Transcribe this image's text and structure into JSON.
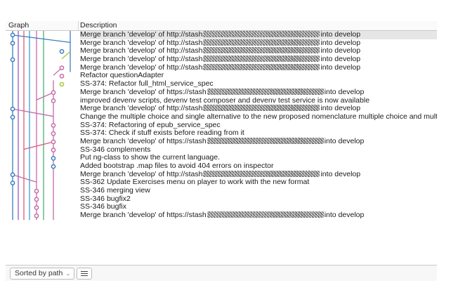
{
  "header": {
    "graph": "Graph",
    "description": "Description"
  },
  "commits": [
    {
      "pre": "Merge branch 'develop' of http://stash",
      "redact": 166,
      "post": "into develop",
      "dot": 0,
      "color": "#3a7fc0"
    },
    {
      "pre": "Merge branch 'develop' of http://stash",
      "redact": 166,
      "post": "into develop",
      "dot": 0,
      "color": "#3a7fc0"
    },
    {
      "pre": "Merge branch 'develop' of http://stash",
      "redact": 166,
      "post": "into develop",
      "dot": 7,
      "color": "#3a7fc0"
    },
    {
      "pre": "Merge branch 'develop' of http://stash",
      "redact": 166,
      "post": "into develop",
      "dot": 0,
      "color": "#3a7fc0"
    },
    {
      "pre": "Merge branch 'develop' of http://stash",
      "redact": 166,
      "post": "into develop",
      "dot": 7,
      "color": "#c56aa8"
    },
    {
      "pre": "Refactor questionAdapter",
      "dot": 7,
      "color": "#c56aa8"
    },
    {
      "pre": "SS-374: Refactor full_html_service_spec",
      "dot": 7,
      "color": "#a8c83a"
    },
    {
      "pre": "Merge branch 'develop' of https://stash",
      "redact": 166,
      "post": "into develop",
      "dot": 6,
      "color": "#c56aa8"
    },
    {
      "pre": "improved devenv scripts, devenv test composer and devenv test service is now available",
      "dot": 6,
      "color": "#c56aa8"
    },
    {
      "pre": "Merge branch 'develop' of http://stash",
      "redact": 166,
      "post": "into develop",
      "dot": 0,
      "color": "#3a7fc0"
    },
    {
      "pre": "Change the multiple choice and single alternative to the new proposed nomenclature multiple choice and multiple answers",
      "dot": 0,
      "color": "#3a7fc0"
    },
    {
      "pre": "SS-374: Refactoring of epub_service_spec",
      "dot": 6,
      "color": "#c56aa8"
    },
    {
      "pre": "SS-374: Check if stuff exists before reading from it",
      "dot": 6,
      "color": "#c56aa8"
    },
    {
      "pre": "Merge branch 'develop' of https://stash",
      "redact": 166,
      "post": "into develop",
      "dot": 6,
      "color": "#c56aa8"
    },
    {
      "pre": "SS-346 complements",
      "dot": 6,
      "color": "#c56aa8"
    },
    {
      "pre": "Put ng-class to show the current language.",
      "dot": 6,
      "color": "#3a7fc0"
    },
    {
      "pre": "Added bootstrap .map files to avoid 404 errors on inspector",
      "dot": 6,
      "color": "#3a7fc0"
    },
    {
      "pre": "Merge branch 'develop' of http://stash",
      "redact": 166,
      "post": "into develop",
      "dot": 0,
      "color": "#3a7fc0"
    },
    {
      "pre": "SS-362 Update Exercises menu on player to work with the new format",
      "dot": 0,
      "color": "#3a7fc0"
    },
    {
      "pre": "SS-346 merging view",
      "dot": 4,
      "color": "#c56aa8"
    },
    {
      "pre": "SS-346 bugfix2",
      "dot": 4,
      "color": "#c56aa8"
    },
    {
      "pre": "SS-346 bugfix",
      "dot": 4,
      "color": "#c56aa8"
    },
    {
      "pre": "Merge branch 'develop' of https://stash",
      "redact": 166,
      "post": "into develop",
      "dot": 4,
      "color": "#c56aa8"
    }
  ],
  "footer": {
    "sort_label": "Sorted by path"
  }
}
